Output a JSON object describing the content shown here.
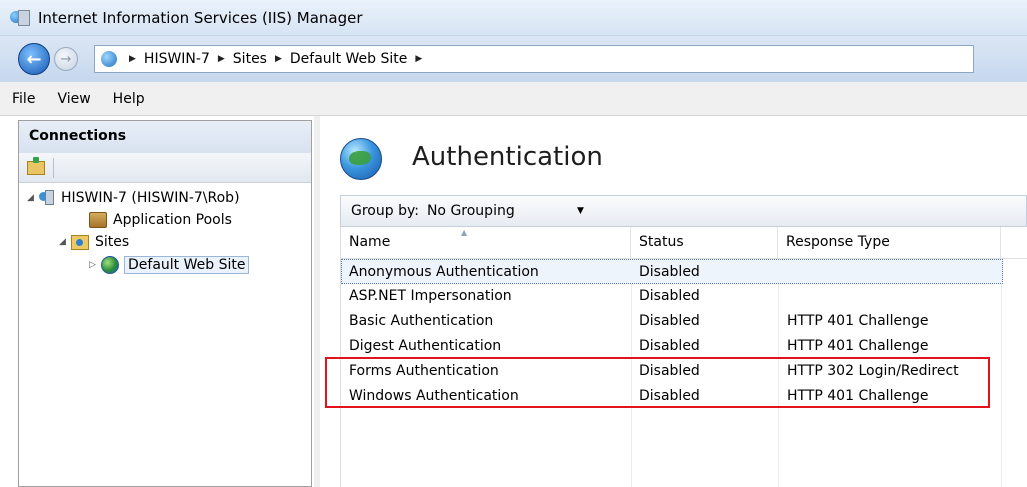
{
  "window": {
    "title": "Internet Information Services (IIS) Manager"
  },
  "address": {
    "crumbs": [
      "HISWIN-7",
      "Sites",
      "Default Web Site"
    ]
  },
  "menu": {
    "items": [
      "File",
      "View",
      "Help"
    ]
  },
  "connections": {
    "header": "Connections",
    "tree": {
      "server": "HISWIN-7 (HISWIN-7\\Rob)",
      "app_pools": "Application Pools",
      "sites": "Sites",
      "site": "Default Web Site"
    }
  },
  "feature": {
    "title": "Authentication",
    "group_by_label": "Group by:",
    "group_by_value": "No Grouping",
    "columns": [
      "Name",
      "Status",
      "Response Type"
    ],
    "rows": [
      {
        "name": "Anonymous Authentication",
        "status": "Disabled",
        "response": ""
      },
      {
        "name": "ASP.NET Impersonation",
        "status": "Disabled",
        "response": ""
      },
      {
        "name": "Basic Authentication",
        "status": "Disabled",
        "response": "HTTP 401 Challenge"
      },
      {
        "name": "Digest Authentication",
        "status": "Disabled",
        "response": "HTTP 401 Challenge"
      },
      {
        "name": "Forms Authentication",
        "status": "Disabled",
        "response": "HTTP 302 Login/Redirect"
      },
      {
        "name": "Windows Authentication",
        "status": "Disabled",
        "response": "HTTP 401 Challenge"
      }
    ]
  },
  "colors": {
    "highlight": "#e4121b",
    "selection": "#eef4fc"
  }
}
